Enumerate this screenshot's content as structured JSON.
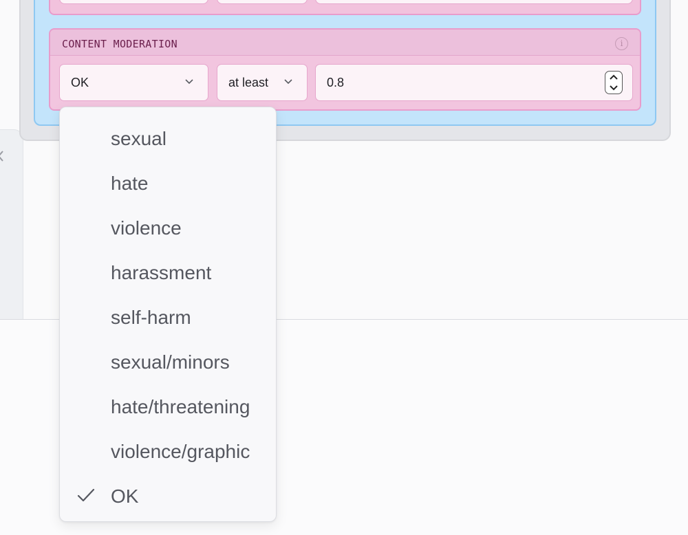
{
  "card": {
    "title": "CONTENT MODERATION",
    "info_icon": "info-icon",
    "category_select": {
      "value": "OK",
      "icon": "chevron-down-icon"
    },
    "operator_select": {
      "value": "at least",
      "icon": "chevron-down-icon"
    },
    "threshold_input": {
      "value": "0.8",
      "icon": "stepper-icon"
    }
  },
  "dropdown": {
    "options": [
      {
        "label": "sexual",
        "selected": false
      },
      {
        "label": "hate",
        "selected": false
      },
      {
        "label": "violence",
        "selected": false
      },
      {
        "label": "harassment",
        "selected": false
      },
      {
        "label": "self-harm",
        "selected": false
      },
      {
        "label": "sexual/minors",
        "selected": false
      },
      {
        "label": "hate/threatening",
        "selected": false
      },
      {
        "label": "violence/graphic",
        "selected": false
      },
      {
        "label": "OK",
        "selected": true
      }
    ],
    "check_icon": "checkmark-icon"
  },
  "colors": {
    "card_bg": "#f2c5df",
    "card_border": "#e89ccb",
    "title_text": "#6b1f4c",
    "blue_container": "#c3e4fb",
    "grey_container": "#e4e5e9"
  }
}
